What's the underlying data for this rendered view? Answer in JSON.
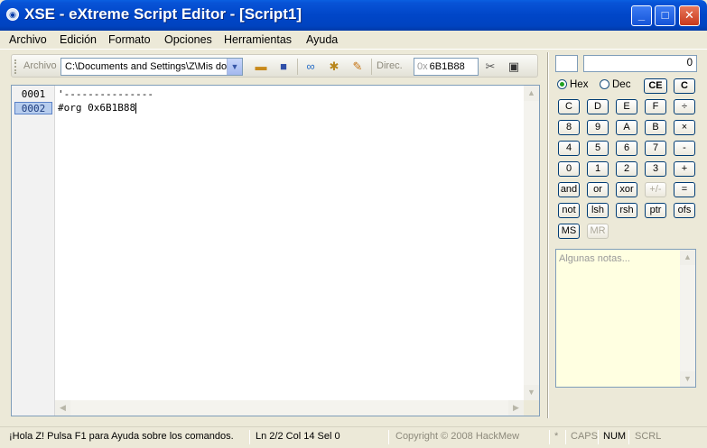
{
  "window": {
    "title": "XSE - eXtreme Script Editor - [Script1]",
    "minimize": "_",
    "maximize": "□",
    "close": "✕"
  },
  "menu": [
    "Archivo",
    "Edición",
    "Formato",
    "Opciones",
    "Herramientas",
    "Ayuda"
  ],
  "toolbar": {
    "archivo_label": "Archivo",
    "path": "C:\\Documents and Settings\\Z\\Mis do",
    "direc_label": "Direc.",
    "addr_prefix": "0x",
    "addr_value": "6B1B88",
    "icons": [
      "open-icon",
      "save-icon",
      "link-icon",
      "compile-icon",
      "edit-icon",
      "cut-icon",
      "stop-icon"
    ]
  },
  "editor": {
    "lines": [
      {
        "num": "0001",
        "text": "'---------------"
      },
      {
        "num": "0002",
        "text": "#org 0x6B1B88"
      }
    ],
    "active_line": 2
  },
  "calculator": {
    "display": "0",
    "memory_display": "",
    "mode_hex": "Hex",
    "mode_dec": "Dec",
    "selected_mode": "Hex",
    "buttons": {
      "ce": "CE",
      "c_clear": "C",
      "r1": [
        "C",
        "D",
        "E",
        "F",
        "÷"
      ],
      "r2": [
        "8",
        "9",
        "A",
        "B",
        "×"
      ],
      "r3": [
        "4",
        "5",
        "6",
        "7",
        "-"
      ],
      "r4": [
        "0",
        "1",
        "2",
        "3",
        "+"
      ],
      "r5": [
        "and",
        "or",
        "xor",
        "+/-",
        "="
      ],
      "r6": [
        "not",
        "lsh",
        "rsh",
        "ptr",
        "ofs"
      ],
      "ms": "MS",
      "mr": "MR"
    },
    "notes_placeholder": "Algunas notas..."
  },
  "status": {
    "help": "¡Hola Z! Pulsa F1 para Ayuda sobre los comandos.",
    "position": "Ln 2/2  Col 14  Sel 0",
    "copyright": "Copyright © 2008 HackMew",
    "modified": "*",
    "caps": "CAPS",
    "num": "NUM",
    "scrl": "SCRL"
  }
}
